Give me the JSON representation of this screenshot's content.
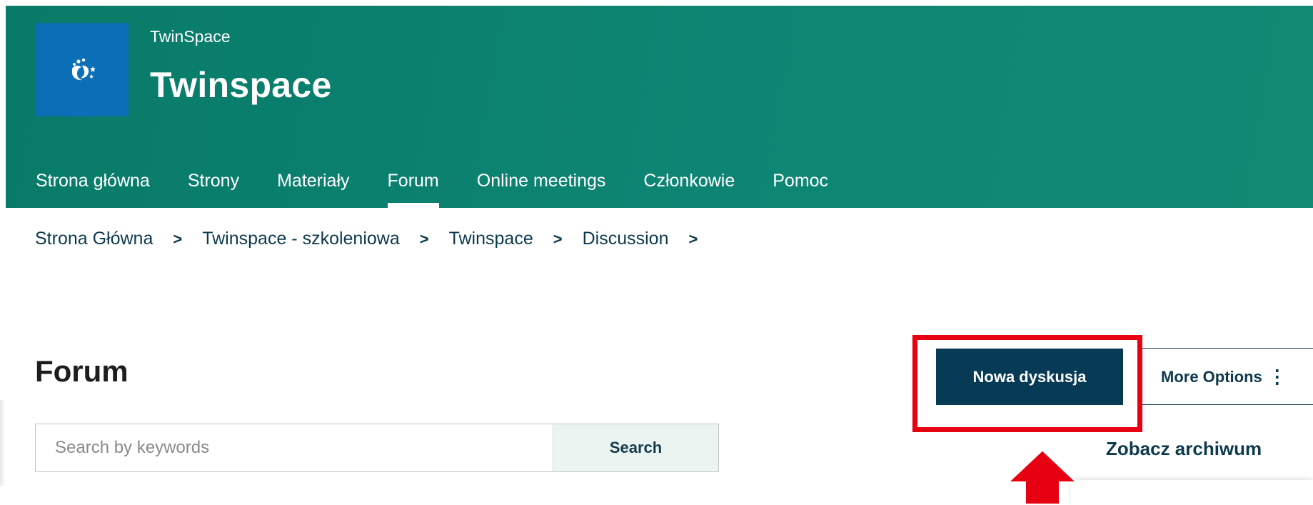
{
  "header": {
    "site_subtitle": "TwinSpace",
    "site_title": "Twinspace",
    "logo_icon": "etwinning-stars-logo"
  },
  "nav": {
    "items": [
      {
        "label": "Strona główna",
        "active": false
      },
      {
        "label": "Strony",
        "active": false
      },
      {
        "label": "Materiały",
        "active": false
      },
      {
        "label": "Forum",
        "active": true
      },
      {
        "label": "Online meetings",
        "active": false
      },
      {
        "label": "Członkowie",
        "active": false
      },
      {
        "label": "Pomoc",
        "active": false
      }
    ]
  },
  "breadcrumb": {
    "items": [
      "Strona Główna",
      "Twinspace - szkoleniowa",
      "Twinspace",
      "Discussion"
    ],
    "separator": ">"
  },
  "main": {
    "page_title": "Forum",
    "search": {
      "placeholder": "Search by keywords",
      "value": "",
      "button_label": "Search"
    },
    "actions": {
      "new_discussion_label": "Nowa dyskusja",
      "more_options_label": "More Options",
      "more_options_icon": "kebab-menu-icon",
      "archive_label": "Zobacz archiwum"
    }
  },
  "annotation": {
    "highlight_color": "#e60012",
    "arrow_color": "#e60012"
  },
  "colors": {
    "header_green": "#0e8574",
    "logo_blue": "#0a6fb7",
    "primary_button": "#063a55",
    "text_dark_blue": "#0d3a4d"
  }
}
